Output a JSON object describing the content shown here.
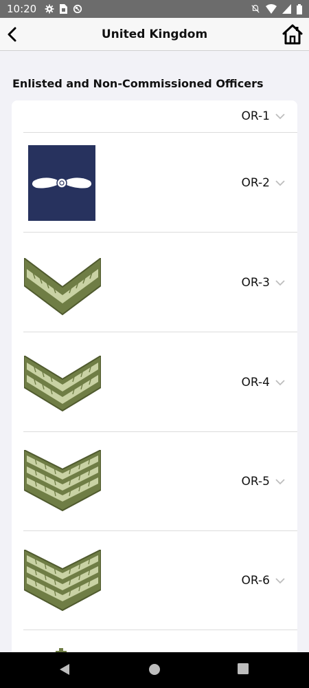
{
  "status_bar": {
    "time": "10:20",
    "left_icons": [
      "gear-icon",
      "sim-card-icon",
      "sync-icon"
    ],
    "right_icons": [
      "notifications-off-icon",
      "wifi-icon",
      "signal-icon",
      "battery-icon"
    ]
  },
  "header": {
    "title": "United Kingdom",
    "back_icon": "chevron-left-icon",
    "home_icon": "home-icon"
  },
  "section": {
    "title": "Enlisted and Non-Commissioned Officers"
  },
  "ranks": [
    {
      "code": "OR-1",
      "insignia": "none"
    },
    {
      "code": "OR-2",
      "insignia": "propeller-on-navy"
    },
    {
      "code": "OR-3",
      "insignia": "one-chevron"
    },
    {
      "code": "OR-4",
      "insignia": "two-chevrons"
    },
    {
      "code": "OR-5",
      "insignia": "three-chevrons"
    },
    {
      "code": "OR-6",
      "insignia": "three-chevrons"
    }
  ],
  "colors": {
    "status_bar": "#6c6c6c",
    "chevron_green": "#6f7d45",
    "chevron_stripe": "#c9d2a4",
    "navy": "#27325e"
  },
  "nav_bar": {
    "icons": [
      "back-triangle-icon",
      "home-circle-icon",
      "recents-square-icon"
    ]
  }
}
